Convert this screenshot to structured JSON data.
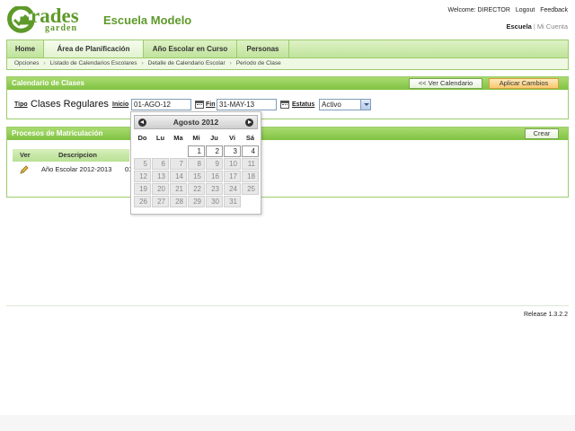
{
  "logo": {
    "text_main": "rades",
    "text_sub": "garden",
    "brand_color": "#5e9a2a"
  },
  "school_name": "Escuela Modelo",
  "user_links": {
    "welcome": "Welcome: DIRECTOR",
    "logout": "Logout",
    "feedback": "Feedback"
  },
  "school_links": {
    "active": "Escuela",
    "separator": "|",
    "other": "Mi Cuenta"
  },
  "nav": {
    "items": [
      {
        "label": "Home"
      },
      {
        "label": "Área de Planificación"
      },
      {
        "label": "Año Escolar en Curso"
      },
      {
        "label": "Personas"
      }
    ],
    "active_index": 1
  },
  "breadcrumb": [
    "Opciones",
    "Listado de Calendarios Escolares",
    "Detalle de Calendario Escolar",
    "Periodo de Clase"
  ],
  "panel_calendario": {
    "title": "Calendario de Clases",
    "btn_back": "<< Ver Calendario",
    "btn_apply": "Aplicar Cambios",
    "tipo_label": "Tipo",
    "tipo_value": "Clases Regulares",
    "inicio_label": "Inicio",
    "inicio_value": "01-AGO-12",
    "fin_label": "Fin",
    "fin_value": "31-MAY-13",
    "estatus_label": "Estatus",
    "estatus_value": "Activo"
  },
  "panel_procesos": {
    "title": "Procesos de Matriculación",
    "btn_create": "Crear",
    "columns": [
      "Ver",
      "Descripcion"
    ],
    "rows": [
      {
        "descripcion": "Año Escolar 2012-2013",
        "extra": "01"
      }
    ]
  },
  "calendar": {
    "month_label": "Agosto 2012",
    "weekdays": [
      "Do",
      "Lu",
      "Ma",
      "Mi",
      "Ju",
      "Vi",
      "Sá"
    ],
    "weeks": [
      [
        "",
        "",
        "",
        "1",
        "2",
        "3",
        "4"
      ],
      [
        "5",
        "6",
        "7",
        "8",
        "9",
        "10",
        "11"
      ],
      [
        "12",
        "13",
        "14",
        "15",
        "16",
        "17",
        "18"
      ],
      [
        "19",
        "20",
        "21",
        "22",
        "23",
        "24",
        "25"
      ],
      [
        "26",
        "27",
        "28",
        "29",
        "30",
        "31",
        ""
      ]
    ],
    "selected_day": "1"
  },
  "footer": {
    "release": "Release 1.3.2.2"
  },
  "colors": {
    "accent_green": "#7fc241",
    "border_green": "#9ccc6c",
    "apply_orange": "#f8c86e"
  }
}
